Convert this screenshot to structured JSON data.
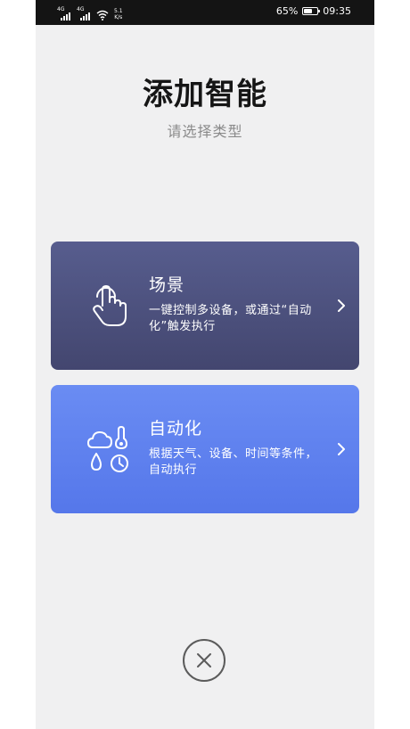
{
  "status_bar": {
    "sim1_tag": "4G",
    "sim2_tag": "4G",
    "net_speed_value": "5.1",
    "net_speed_unit": "K/s",
    "battery_percent": "65%",
    "battery_level": 0.65,
    "time": "09:35"
  },
  "header": {
    "title": "添加智能",
    "subtitle": "请选择类型"
  },
  "cards": [
    {
      "title": "场景",
      "description": "一键控制多设备，或通过“自动化”触发执行",
      "icon": "hand-pointer-icon",
      "color_top": "#575d8e",
      "color_bottom": "#43466f"
    },
    {
      "title": "自动化",
      "description": "根据天气、设备、时间等条件，自动执行",
      "icon": "weather-clock-icon",
      "color_top": "#6a8cf3",
      "color_bottom": "#5577ea"
    }
  ],
  "close_button": {
    "icon": "close-icon"
  },
  "colors": {
    "background": "#f0f0f1",
    "status_bar": "#141414",
    "title": "#161616",
    "subtitle": "#8a8a8a"
  }
}
